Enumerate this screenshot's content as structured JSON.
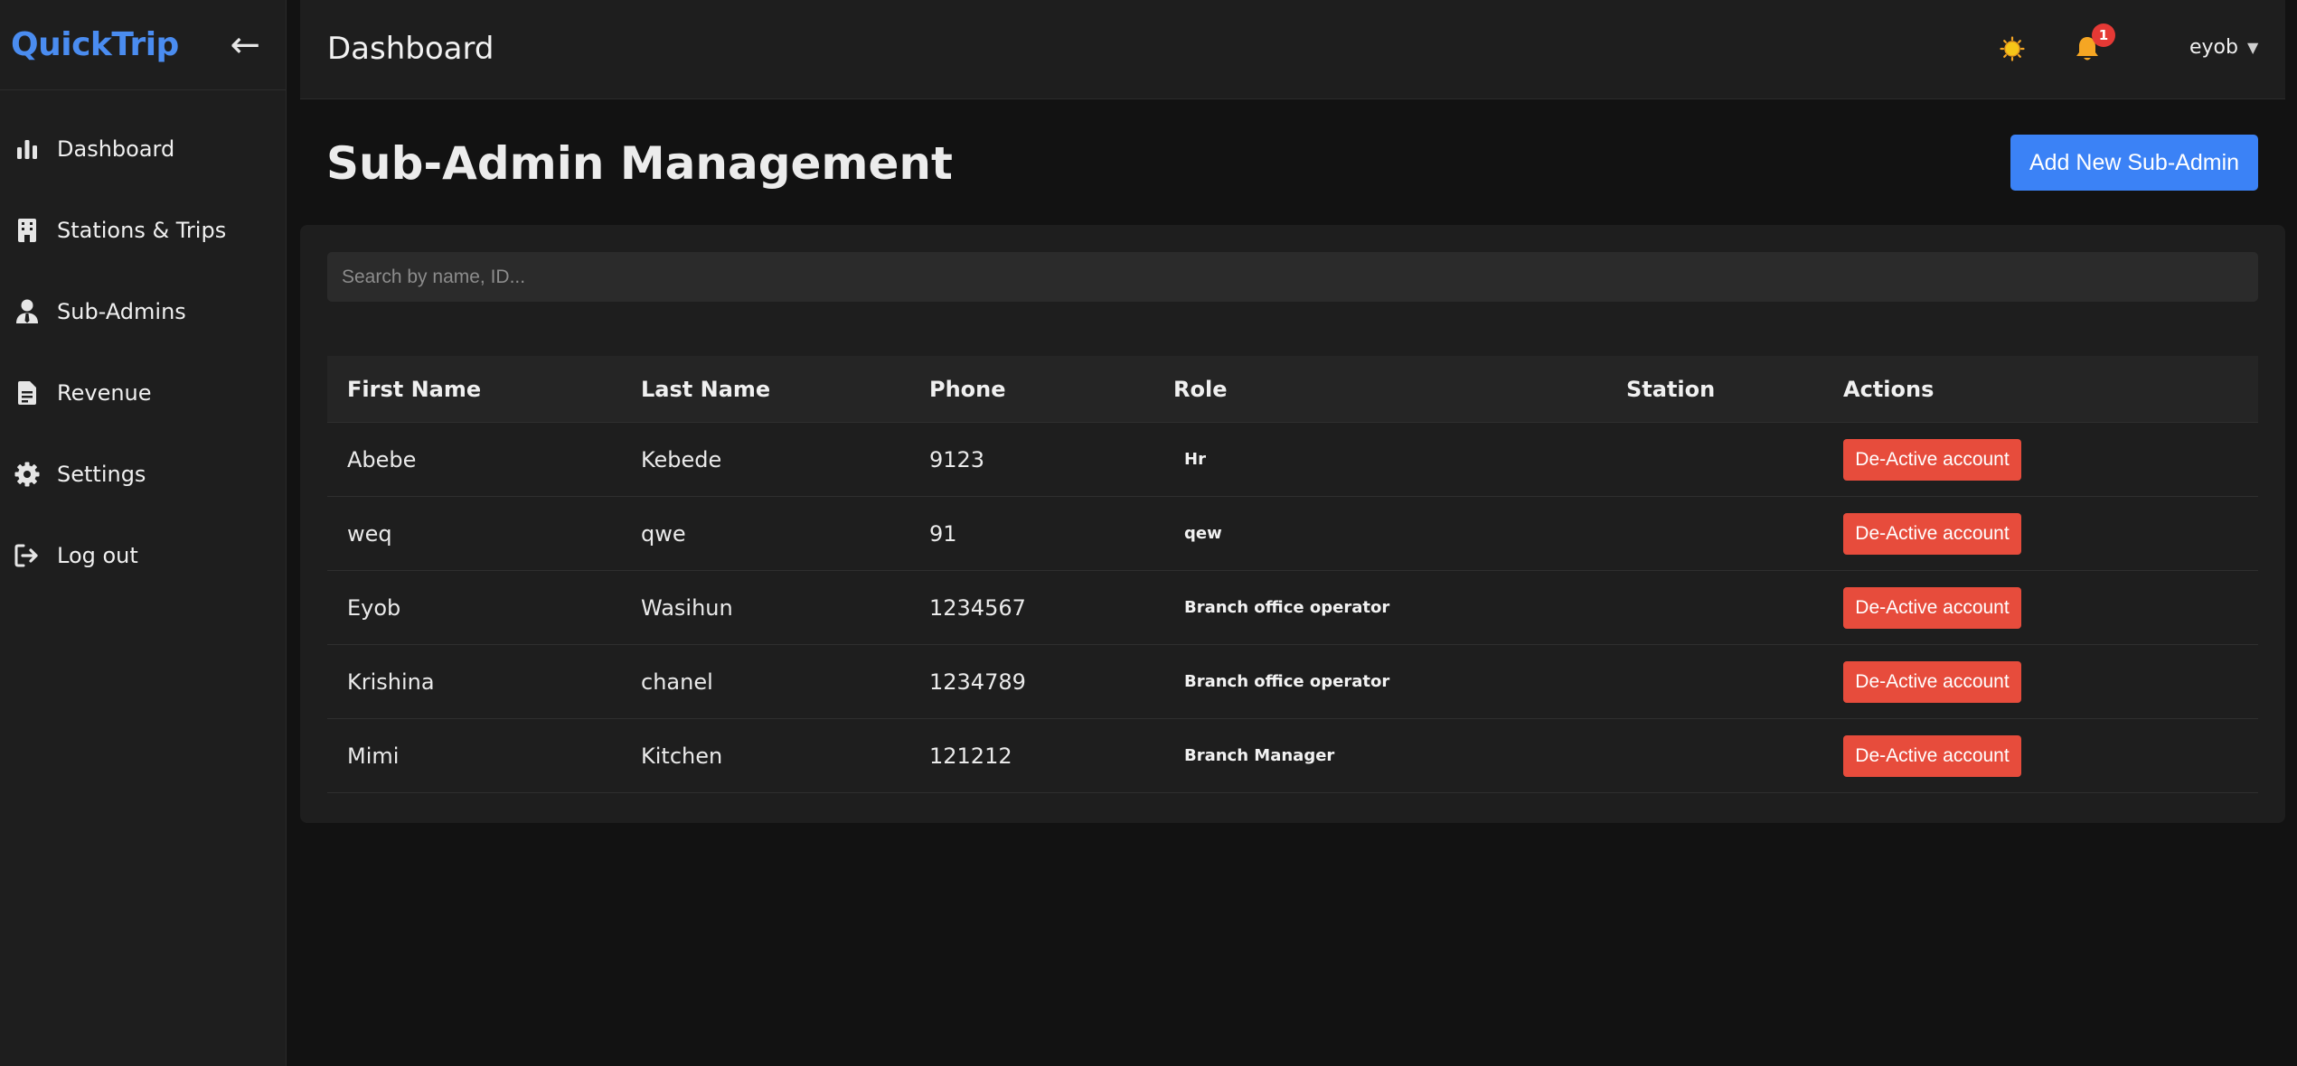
{
  "sidebar": {
    "brand": "QuickTrip",
    "collapse_glyph": "←",
    "items": [
      {
        "label": "Dashboard",
        "icon": "bar-chart-icon"
      },
      {
        "label": "Stations & Trips",
        "icon": "building-icon"
      },
      {
        "label": "Sub-Admins",
        "icon": "user-tie-icon"
      },
      {
        "label": "Revenue",
        "icon": "file-invoice-icon"
      },
      {
        "label": "Settings",
        "icon": "gear-icon"
      },
      {
        "label": "Log out",
        "icon": "logout-icon"
      }
    ]
  },
  "header": {
    "title": "Dashboard",
    "notification_count": "1",
    "user": "eyob",
    "user_caret": "▼"
  },
  "main": {
    "title": "Sub-Admin Management",
    "add_button": "Add New Sub-Admin",
    "search_placeholder": "Search by name, ID...",
    "columns": [
      "First Name",
      "Last Name",
      "Phone",
      "Role",
      "Station",
      "Actions"
    ],
    "rows": [
      {
        "first": "Abebe",
        "last": "Kebede",
        "phone": "9123",
        "role": "Hr",
        "station": "",
        "action": "De-Active account"
      },
      {
        "first": "weq",
        "last": "qwe",
        "phone": "91",
        "role": "qew",
        "station": "",
        "action": "De-Active account"
      },
      {
        "first": "Eyob",
        "last": "Wasihun",
        "phone": "1234567",
        "role": "Branch office operator",
        "station": "",
        "action": "De-Active account"
      },
      {
        "first": "Krishina",
        "last": "chanel",
        "phone": "1234789",
        "role": "Branch office operator",
        "station": "",
        "action": "De-Active account"
      },
      {
        "first": "Mimi",
        "last": "Kitchen",
        "phone": "121212",
        "role": "Branch Manager",
        "station": "",
        "action": "De-Active account"
      }
    ]
  },
  "colors": {
    "brand": "#4a8cf0",
    "primary_button": "#3b82f6",
    "danger_button": "#e74c3c",
    "badge": "#e53935",
    "background": "#121212",
    "surface": "#1e1e1e"
  }
}
